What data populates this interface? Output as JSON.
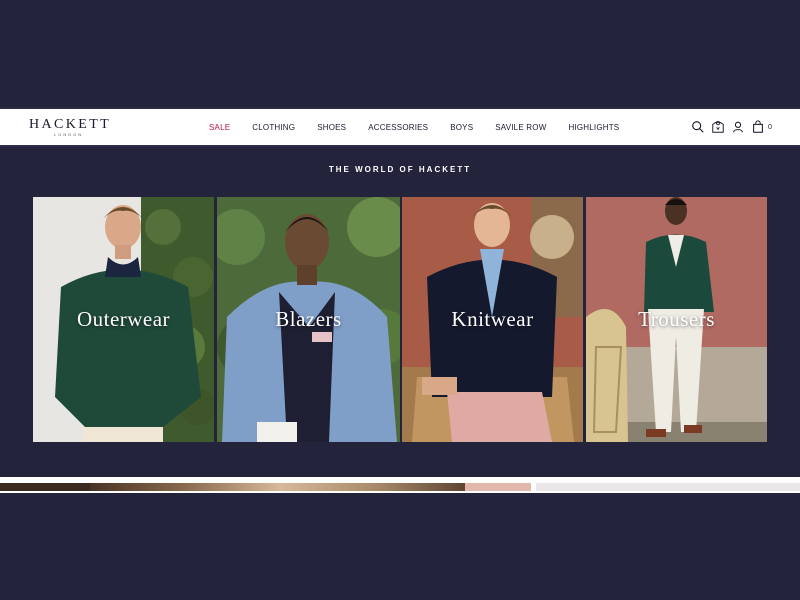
{
  "brand": {
    "name": "HACKETT",
    "sub": "LONDON"
  },
  "nav": {
    "items": [
      {
        "label": "SALE",
        "highlight": true
      },
      {
        "label": "CLOTHING"
      },
      {
        "label": "SHOES"
      },
      {
        "label": "ACCESSORIES"
      },
      {
        "label": "BOYS"
      },
      {
        "label": "SAVILE ROW"
      },
      {
        "label": "HIGHLIGHTS"
      }
    ]
  },
  "header_icons": [
    "search-icon",
    "store-locator-icon",
    "account-icon",
    "bag-icon"
  ],
  "bag_count": "0",
  "section_title": "THE WORLD OF HACKETT",
  "categories": [
    {
      "label": "Outerwear"
    },
    {
      "label": "Blazers"
    },
    {
      "label": "Knitwear"
    },
    {
      "label": "Trousers"
    }
  ],
  "colors": {
    "background": "#23233b",
    "sale": "#b8164a",
    "header": "#ffffff"
  }
}
